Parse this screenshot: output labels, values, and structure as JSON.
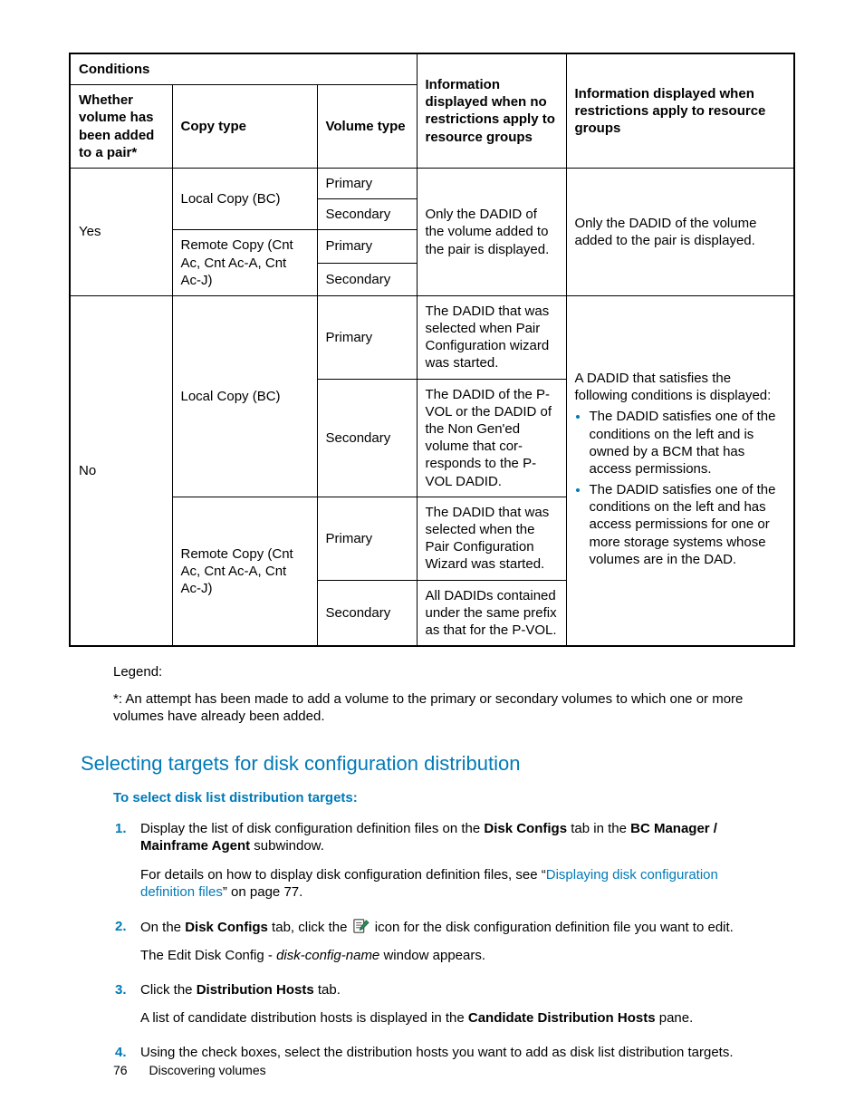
{
  "table": {
    "headers": {
      "conditions": "Conditions",
      "whether": "Whether volume has been added to a pair*",
      "copy_type": "Copy type",
      "volume_type": "Volume type",
      "info_no_restrict": "Information displayed when no restrictions apply to resource groups",
      "info_restrict": "Information displayed when restric­tions apply to resource groups"
    },
    "rows": {
      "yes": "Yes",
      "no": "No",
      "local_copy": "Local Copy (BC)",
      "remote_copy": "Remote Copy (Cnt Ac, Cnt Ac-A, Cnt Ac-J)",
      "primary": "Primary",
      "secondary": "Secondary",
      "yes_info_left": "Only the DADID of the volume added to the pair is displayed.",
      "yes_info_right": "Only the DADID of the volume added to the pair is displayed.",
      "no_local_primary": "The DADID that was se­lected when Pair Config­uration wizard was star­ted.",
      "no_local_secondary": "The DADID of the P-VOL or the DADID of the Non Gen'ed volume that cor­responds to the P-VOL DADID.",
      "no_remote_primary": "The DADID that was se­lected when the Pair Configuration Wizard was started.",
      "no_remote_secondary": "All DADIDs contained under the same prefix as that for the P-VOL.",
      "no_restrict_intro": "A DADID that satisfies the following conditions is displayed:",
      "no_restrict_b1": "The DADID satisfies one of the condi­tions on the left and  is owned by a BCM that has access permissions.",
      "no_restrict_b2": "The DADID satisfies one of the condi­tions on the left and has access permis­sions for one or more storage systems whose volumes are in the DAD."
    }
  },
  "legend": {
    "label": "Legend:",
    "text": "*: An attempt has been made to add a volume to the primary or secondary volumes to which one or more volumes have already been added."
  },
  "section_heading": "Selecting targets for disk configuration distribution",
  "sub_heading": "To select disk list distribution targets:",
  "steps": {
    "s1": {
      "p1a": "Display the list of disk configuration definition files on the ",
      "p1b": "Disk Configs",
      "p1c": " tab in the ",
      "p1d": "BC Manager / Mainframe Agent",
      "p1e": " subwindow.",
      "p2a": "For details on how to display disk configuration definition files, see “",
      "p2b": "Displaying disk configuration definition files",
      "p2c": "” on page 77."
    },
    "s2": {
      "p1a": "On the ",
      "p1b": "Disk Configs",
      "p1c": " tab, click the ",
      "p1d": " icon for the disk configuration definition file you want to edit.",
      "p2a": "The Edit Disk Config - ",
      "p2b": "disk-config-name",
      "p2c": " window appears."
    },
    "s3": {
      "p1a": "Click the ",
      "p1b": "Distribution Hosts",
      "p1c": " tab.",
      "p2a": "A list of candidate distribution hosts is displayed in the ",
      "p2b": "Candidate Distribution Hosts",
      "p2c": " pane."
    },
    "s4": {
      "p1": "Using the check boxes, select the distribution hosts you want to add as disk list distribution targets."
    }
  },
  "footer": {
    "page": "76",
    "title": "Discovering volumes"
  }
}
